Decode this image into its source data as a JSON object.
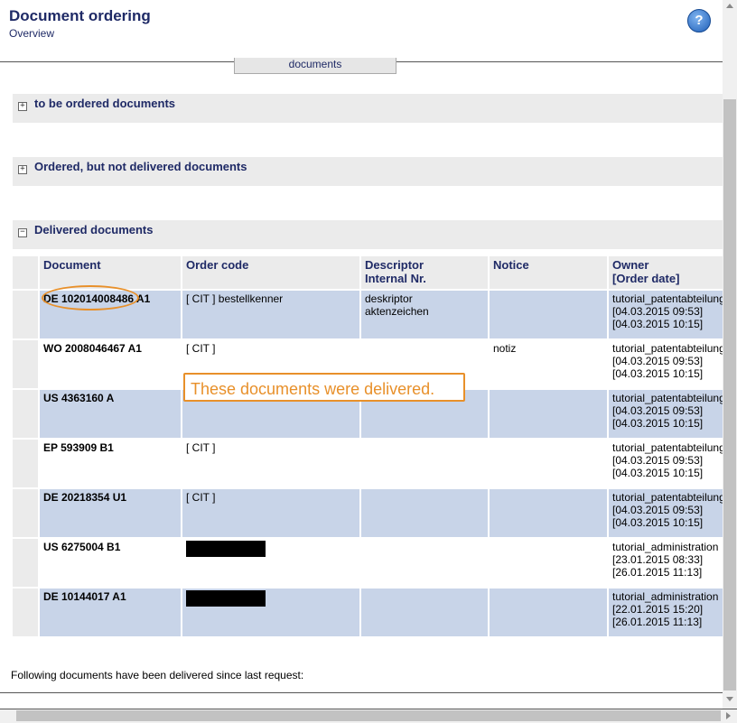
{
  "header": {
    "title": "Document ordering",
    "subtitle": "Overview",
    "help_icon": "?"
  },
  "top_button": {
    "label": "documents"
  },
  "sections": [
    {
      "label": "to be ordered documents",
      "toggle": "+"
    },
    {
      "label": "Ordered, but not delivered documents",
      "toggle": "+"
    },
    {
      "label": "Delivered documents",
      "toggle": "−"
    }
  ],
  "table": {
    "headers": {
      "document": "Document",
      "order_code": "Order code",
      "descriptor": "Descriptor",
      "internal_nr": "Internal Nr.",
      "notice": "Notice",
      "owner": "Owner",
      "order_date": "[Order date]"
    },
    "rows": [
      {
        "document": "DE 102014008486 A1",
        "order_code": "[ CIT ] bestellkenner",
        "descriptor": "deskriptor",
        "internal_nr": "aktenzeichen",
        "notice": "",
        "owner": "tutorial_patentabteilung",
        "date1": "[04.03.2015 09:53]",
        "date2": "[04.03.2015 10:15]"
      },
      {
        "document": "WO 2008046467 A1",
        "order_code": "[ CIT ]",
        "descriptor": "",
        "internal_nr": "",
        "notice": "notiz",
        "owner": "tutorial_patentabteilung",
        "date1": "[04.03.2015 09:53]",
        "date2": "[04.03.2015 10:15]"
      },
      {
        "document": "US 4363160 A",
        "order_code": "",
        "descriptor": "",
        "internal_nr": "",
        "notice": "",
        "owner": "tutorial_patentabteilung",
        "date1": "[04.03.2015 09:53]",
        "date2": "[04.03.2015 10:15]"
      },
      {
        "document": "EP 593909 B1",
        "order_code": "[ CIT ]",
        "descriptor": "",
        "internal_nr": "",
        "notice": "",
        "owner": "tutorial_patentabteilung",
        "date1": "[04.03.2015 09:53]",
        "date2": "[04.03.2015 10:15]"
      },
      {
        "document": "DE 20218354 U1",
        "order_code": "[ CIT ]",
        "descriptor": "",
        "internal_nr": "",
        "notice": "",
        "owner": "tutorial_patentabteilung",
        "date1": "[04.03.2015 09:53]",
        "date2": "[04.03.2015 10:15]"
      },
      {
        "document": "US 6275004 B1",
        "order_code": "",
        "descriptor": "",
        "internal_nr": "",
        "notice": "",
        "owner": "tutorial_administration",
        "date1": "[23.01.2015 08:33]",
        "date2": "[26.01.2015 11:13]"
      },
      {
        "document": "DE 10144017 A1",
        "order_code": "",
        "descriptor": "",
        "internal_nr": "",
        "notice": "",
        "owner": "tutorial_administration",
        "date1": "[22.01.2015 15:20]",
        "date2": "[26.01.2015 11:13]"
      }
    ]
  },
  "callout": {
    "text": "These documents were delivered."
  },
  "footer": {
    "text": "Following documents have been delivered since last request:"
  },
  "colors": {
    "accent": "#e8902a",
    "title": "#1f2a66",
    "row_shade": "#c8d4e8",
    "section_bg": "#ebebeb"
  }
}
